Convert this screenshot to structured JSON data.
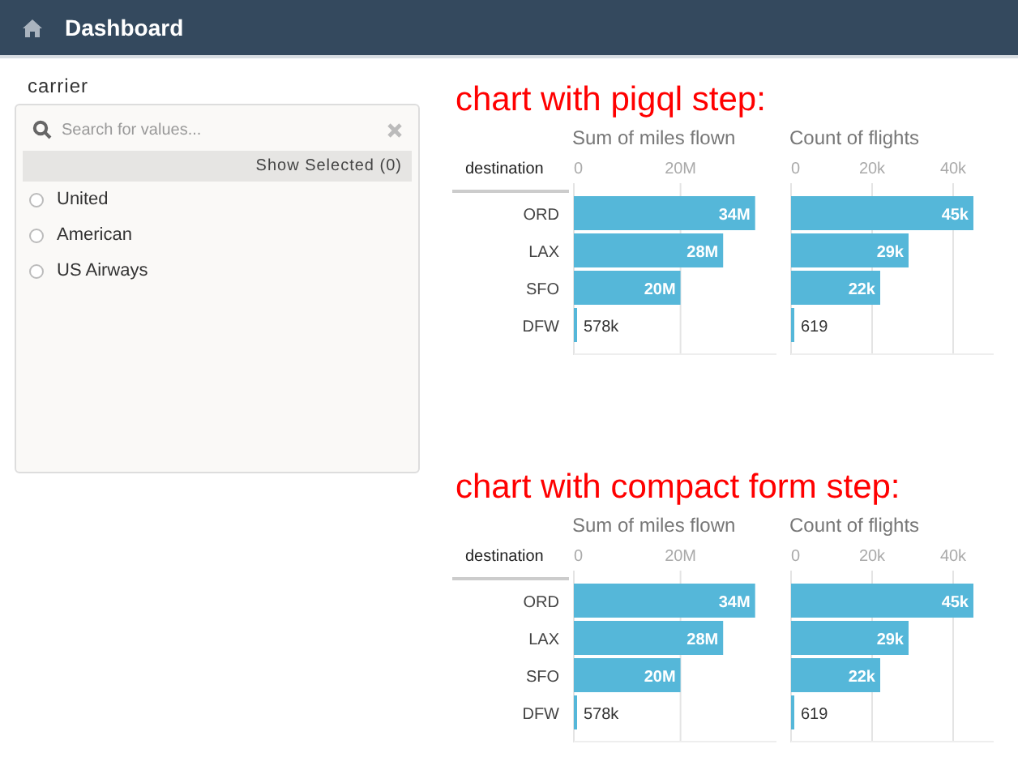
{
  "header": {
    "title": "Dashboard"
  },
  "filter": {
    "label": "carrier",
    "search": {
      "placeholder": "Search for values..."
    },
    "show_selected": "Show Selected (0)",
    "options": [
      {
        "label": "United",
        "selected": false
      },
      {
        "label": "American",
        "selected": false
      },
      {
        "label": "US Airways",
        "selected": false
      }
    ]
  },
  "sections": [
    {
      "title": "chart with pigql step:",
      "row_header": "destination",
      "charts": [
        {
          "chart_data": {
            "type": "bar",
            "orientation": "horizontal",
            "title": "Sum of miles flown",
            "categories": [
              "ORD",
              "LAX",
              "SFO",
              "DFW"
            ],
            "values": [
              34000000,
              28000000,
              20000000,
              578000
            ],
            "xlim": [
              0,
              38000000
            ],
            "xticks": [
              {
                "value": 0,
                "label": "0"
              },
              {
                "value": 20000000,
                "label": "20M"
              }
            ],
            "value_labels": [
              "34M",
              "28M",
              "20M",
              "578k"
            ]
          }
        },
        {
          "chart_data": {
            "type": "bar",
            "orientation": "horizontal",
            "title": "Count of flights",
            "values": [
              45000,
              29000,
              22000,
              619
            ],
            "xlim": [
              0,
              50000
            ],
            "xticks": [
              {
                "value": 0,
                "label": "0"
              },
              {
                "value": 20000,
                "label": "20k"
              },
              {
                "value": 40000,
                "label": "40k"
              }
            ],
            "value_labels": [
              "45k",
              "29k",
              "22k",
              "619"
            ]
          }
        }
      ]
    },
    {
      "title": "chart with compact form step:",
      "row_header": "destination",
      "charts": [
        {
          "chart_data": {
            "type": "bar",
            "orientation": "horizontal",
            "title": "Sum of miles flown",
            "categories": [
              "ORD",
              "LAX",
              "SFO",
              "DFW"
            ],
            "values": [
              34000000,
              28000000,
              20000000,
              578000
            ],
            "xlim": [
              0,
              38000000
            ],
            "xticks": [
              {
                "value": 0,
                "label": "0"
              },
              {
                "value": 20000000,
                "label": "20M"
              }
            ],
            "value_labels": [
              "34M",
              "28M",
              "20M",
              "578k"
            ]
          }
        },
        {
          "chart_data": {
            "type": "bar",
            "orientation": "horizontal",
            "title": "Count of flights",
            "values": [
              45000,
              29000,
              22000,
              619
            ],
            "xlim": [
              0,
              50000
            ],
            "xticks": [
              {
                "value": 0,
                "label": "0"
              },
              {
                "value": 20000,
                "label": "20k"
              },
              {
                "value": 40000,
                "label": "40k"
              }
            ],
            "value_labels": [
              "45k",
              "29k",
              "22k",
              "619"
            ]
          }
        }
      ]
    }
  ]
}
